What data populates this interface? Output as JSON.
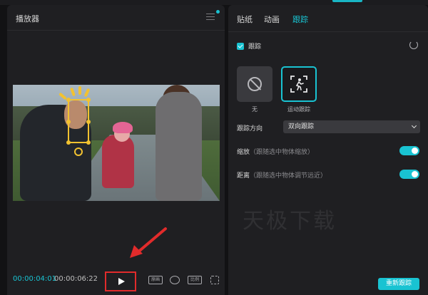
{
  "player": {
    "title": "播放器",
    "time_current": "00:00:04:01",
    "time_total": "00:00:06:22",
    "controls": {
      "quality_label": "原画",
      "ratio_label": "比例"
    }
  },
  "props": {
    "tabs": [
      {
        "label": "贴纸",
        "active": false
      },
      {
        "label": "动画",
        "active": false
      },
      {
        "label": "跟踪",
        "active": true
      }
    ],
    "track_checkbox_label": "跟踪",
    "track_checked": true,
    "options": [
      {
        "label": "无",
        "selected": false
      },
      {
        "label": "运动跟踪",
        "selected": true
      }
    ],
    "direction_label": "跟踪方向",
    "direction_value": "双向跟踪",
    "scale_label": "缩放",
    "scale_hint": "（跟随选中物体缩放）",
    "scale_on": true,
    "distance_label": "距离",
    "distance_hint": "（跟随选中物体调节远近）",
    "distance_on": true,
    "retrack_label": "重新跟踪"
  },
  "watermark": "天极下载",
  "colors": {
    "accent": "#19c3d2",
    "highlight_red": "#e12b2b",
    "tracker_yellow": "#f2c230"
  }
}
